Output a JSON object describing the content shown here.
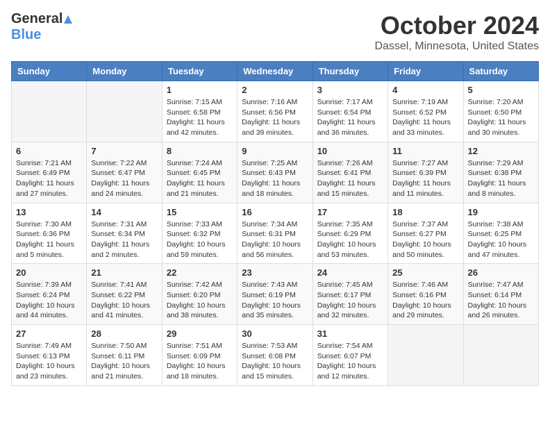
{
  "header": {
    "logo_general": "General",
    "logo_blue": "Blue",
    "month_year": "October 2024",
    "location": "Dassel, Minnesota, United States"
  },
  "weekdays": [
    "Sunday",
    "Monday",
    "Tuesday",
    "Wednesday",
    "Thursday",
    "Friday",
    "Saturday"
  ],
  "weeks": [
    [
      {
        "day": "",
        "info": ""
      },
      {
        "day": "",
        "info": ""
      },
      {
        "day": "1",
        "info": "Sunrise: 7:15 AM\nSunset: 6:58 PM\nDaylight: 11 hours and 42 minutes."
      },
      {
        "day": "2",
        "info": "Sunrise: 7:16 AM\nSunset: 6:56 PM\nDaylight: 11 hours and 39 minutes."
      },
      {
        "day": "3",
        "info": "Sunrise: 7:17 AM\nSunset: 6:54 PM\nDaylight: 11 hours and 36 minutes."
      },
      {
        "day": "4",
        "info": "Sunrise: 7:19 AM\nSunset: 6:52 PM\nDaylight: 11 hours and 33 minutes."
      },
      {
        "day": "5",
        "info": "Sunrise: 7:20 AM\nSunset: 6:50 PM\nDaylight: 11 hours and 30 minutes."
      }
    ],
    [
      {
        "day": "6",
        "info": "Sunrise: 7:21 AM\nSunset: 6:49 PM\nDaylight: 11 hours and 27 minutes."
      },
      {
        "day": "7",
        "info": "Sunrise: 7:22 AM\nSunset: 6:47 PM\nDaylight: 11 hours and 24 minutes."
      },
      {
        "day": "8",
        "info": "Sunrise: 7:24 AM\nSunset: 6:45 PM\nDaylight: 11 hours and 21 minutes."
      },
      {
        "day": "9",
        "info": "Sunrise: 7:25 AM\nSunset: 6:43 PM\nDaylight: 11 hours and 18 minutes."
      },
      {
        "day": "10",
        "info": "Sunrise: 7:26 AM\nSunset: 6:41 PM\nDaylight: 11 hours and 15 minutes."
      },
      {
        "day": "11",
        "info": "Sunrise: 7:27 AM\nSunset: 6:39 PM\nDaylight: 11 hours and 11 minutes."
      },
      {
        "day": "12",
        "info": "Sunrise: 7:29 AM\nSunset: 6:38 PM\nDaylight: 11 hours and 8 minutes."
      }
    ],
    [
      {
        "day": "13",
        "info": "Sunrise: 7:30 AM\nSunset: 6:36 PM\nDaylight: 11 hours and 5 minutes."
      },
      {
        "day": "14",
        "info": "Sunrise: 7:31 AM\nSunset: 6:34 PM\nDaylight: 11 hours and 2 minutes."
      },
      {
        "day": "15",
        "info": "Sunrise: 7:33 AM\nSunset: 6:32 PM\nDaylight: 10 hours and 59 minutes."
      },
      {
        "day": "16",
        "info": "Sunrise: 7:34 AM\nSunset: 6:31 PM\nDaylight: 10 hours and 56 minutes."
      },
      {
        "day": "17",
        "info": "Sunrise: 7:35 AM\nSunset: 6:29 PM\nDaylight: 10 hours and 53 minutes."
      },
      {
        "day": "18",
        "info": "Sunrise: 7:37 AM\nSunset: 6:27 PM\nDaylight: 10 hours and 50 minutes."
      },
      {
        "day": "19",
        "info": "Sunrise: 7:38 AM\nSunset: 6:25 PM\nDaylight: 10 hours and 47 minutes."
      }
    ],
    [
      {
        "day": "20",
        "info": "Sunrise: 7:39 AM\nSunset: 6:24 PM\nDaylight: 10 hours and 44 minutes."
      },
      {
        "day": "21",
        "info": "Sunrise: 7:41 AM\nSunset: 6:22 PM\nDaylight: 10 hours and 41 minutes."
      },
      {
        "day": "22",
        "info": "Sunrise: 7:42 AM\nSunset: 6:20 PM\nDaylight: 10 hours and 38 minutes."
      },
      {
        "day": "23",
        "info": "Sunrise: 7:43 AM\nSunset: 6:19 PM\nDaylight: 10 hours and 35 minutes."
      },
      {
        "day": "24",
        "info": "Sunrise: 7:45 AM\nSunset: 6:17 PM\nDaylight: 10 hours and 32 minutes."
      },
      {
        "day": "25",
        "info": "Sunrise: 7:46 AM\nSunset: 6:16 PM\nDaylight: 10 hours and 29 minutes."
      },
      {
        "day": "26",
        "info": "Sunrise: 7:47 AM\nSunset: 6:14 PM\nDaylight: 10 hours and 26 minutes."
      }
    ],
    [
      {
        "day": "27",
        "info": "Sunrise: 7:49 AM\nSunset: 6:13 PM\nDaylight: 10 hours and 23 minutes."
      },
      {
        "day": "28",
        "info": "Sunrise: 7:50 AM\nSunset: 6:11 PM\nDaylight: 10 hours and 21 minutes."
      },
      {
        "day": "29",
        "info": "Sunrise: 7:51 AM\nSunset: 6:09 PM\nDaylight: 10 hours and 18 minutes."
      },
      {
        "day": "30",
        "info": "Sunrise: 7:53 AM\nSunset: 6:08 PM\nDaylight: 10 hours and 15 minutes."
      },
      {
        "day": "31",
        "info": "Sunrise: 7:54 AM\nSunset: 6:07 PM\nDaylight: 10 hours and 12 minutes."
      },
      {
        "day": "",
        "info": ""
      },
      {
        "day": "",
        "info": ""
      }
    ]
  ]
}
